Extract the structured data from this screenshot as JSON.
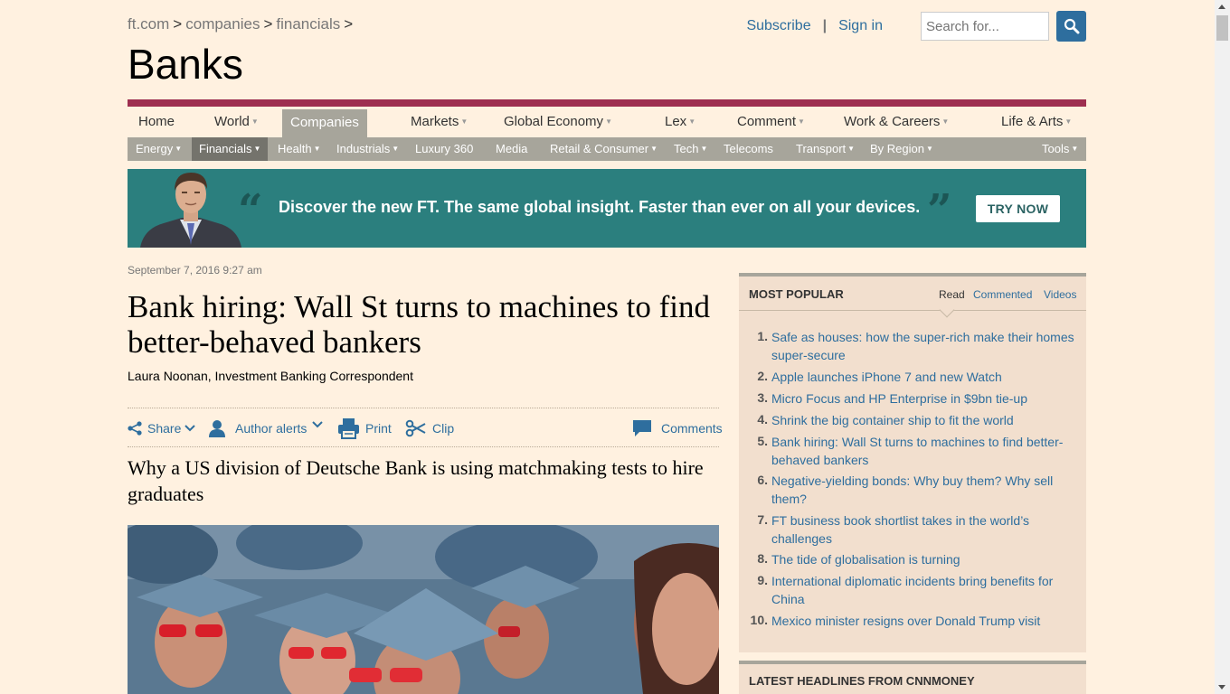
{
  "header": {
    "breadcrumb": [
      "ft.com",
      "companies",
      "financials"
    ],
    "breadcrumb_sep": ">",
    "section_title": "Banks",
    "subscribe": "Subscribe",
    "divider": "|",
    "sign_in": "Sign in",
    "search_placeholder": "Search for...",
    "search_icon": "magnifier-icon"
  },
  "nav": {
    "main": [
      "Home",
      "World",
      "Companies",
      "Markets",
      "Global Economy",
      "Lex",
      "Comment",
      "Work & Careers",
      "Life & Arts"
    ],
    "main_active": "Companies",
    "sub": [
      "Energy",
      "Financials",
      "Health",
      "Industrials",
      "Luxury 360",
      "Media",
      "Retail & Consumer",
      "Tech",
      "Telecoms",
      "Transport",
      "By Region",
      "Tools"
    ],
    "sub_active": "Financials",
    "accent_color": "#9e2f50"
  },
  "banner": {
    "text": "Discover the new FT. The same global insight. Faster than ever on all your devices.",
    "open_quote": "“",
    "close_quote": "”",
    "button": "TRY NOW",
    "background": "#2b7f7e"
  },
  "article": {
    "timestamp": "September 7, 2016 9:27 am",
    "headline": "Bank hiring: Wall St turns to machines to find better-behaved bankers",
    "byline": "Laura Noonan, Investment Banking Correspondent",
    "tools": {
      "share": "Share",
      "author_alerts": "Author alerts",
      "print": "Print",
      "clip": "Clip",
      "comments": "Comments"
    },
    "standfirst": "Why a US division of Deutsche Bank is using matchmaking tests to hire graduates"
  },
  "most_popular": {
    "title": "MOST POPULAR",
    "tabs": [
      "Read",
      "Commented",
      "Videos"
    ],
    "active_tab": "Read",
    "items": [
      {
        "num": "1.",
        "text": "Safe as houses: how the super-rich make their homes super-secure"
      },
      {
        "num": "2.",
        "text": "Apple launches iPhone 7 and new Watch"
      },
      {
        "num": "3.",
        "text": "Micro Focus and HP Enterprise in $9bn tie-up"
      },
      {
        "num": "4.",
        "text": "Shrink the big container ship to fit the world"
      },
      {
        "num": "5.",
        "text": "Bank hiring: Wall St turns to machines to find better-behaved bankers"
      },
      {
        "num": "6.",
        "text": "Negative-yielding bonds: Why buy them? Why sell them?"
      },
      {
        "num": "7.",
        "text": "FT business book shortlist takes in the world’s challenges"
      },
      {
        "num": "8.",
        "text": "The tide of globalisation is turning"
      },
      {
        "num": "9.",
        "text": "International diplomatic incidents bring benefits for China"
      },
      {
        "num": "10.",
        "text": "Mexico minister resigns over Donald Trump visit"
      }
    ]
  },
  "latest": {
    "title": "LATEST HEADLINES FROM CNNMONEY"
  }
}
